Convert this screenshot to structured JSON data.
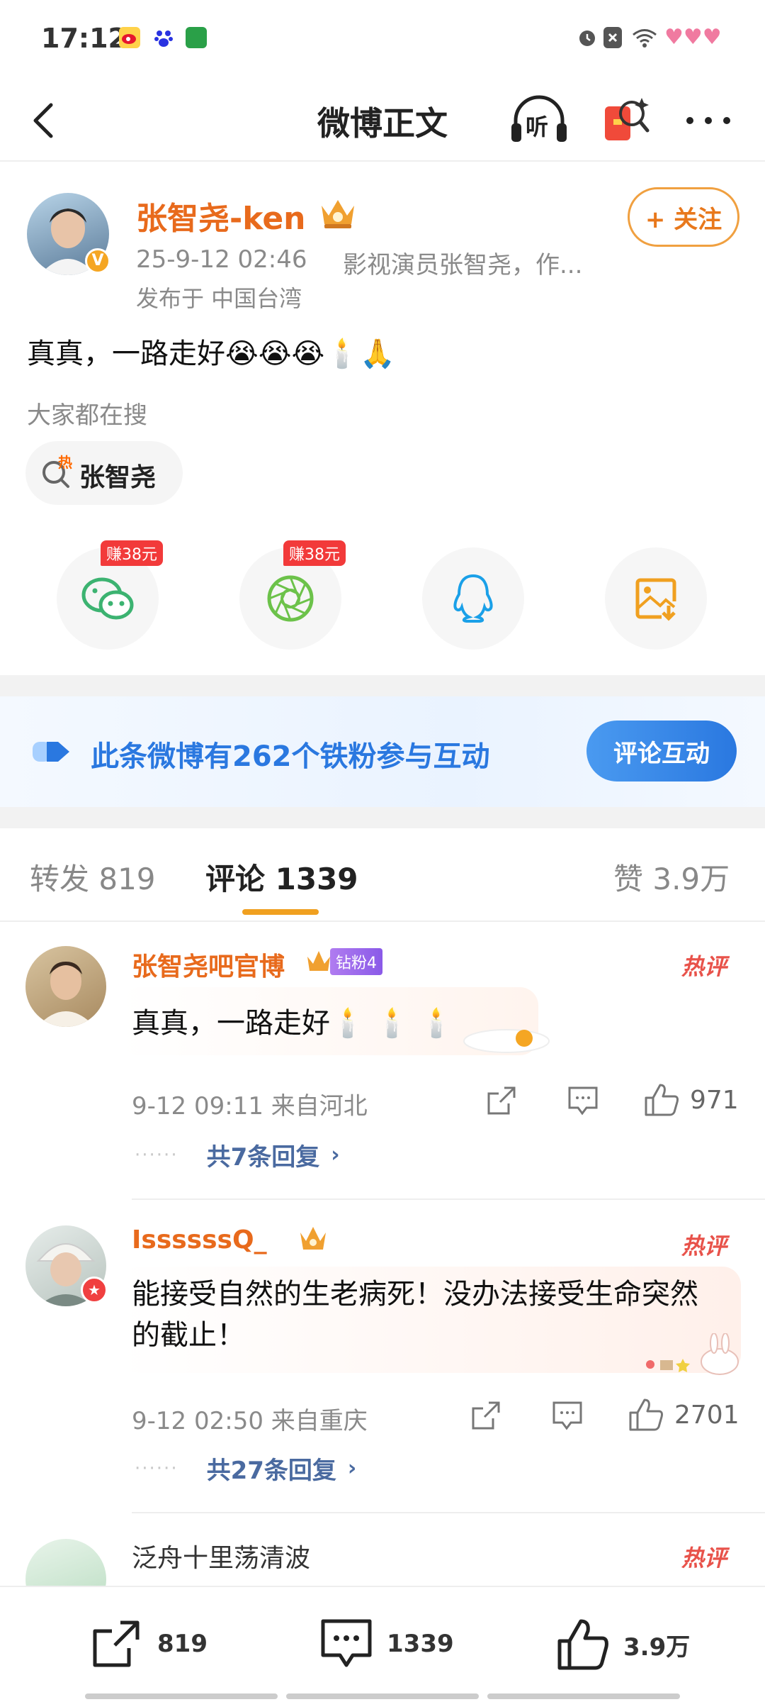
{
  "status_bar": {
    "time": "17:12",
    "left_icons": [
      "weibo-icon",
      "baidu-icon",
      "app-icon"
    ],
    "right_icons": [
      "alarm-icon",
      "close-box-icon",
      "wifi-icon",
      "hearts-icon"
    ]
  },
  "nav": {
    "title": "微博正文",
    "listen_label": "听",
    "icons": [
      "back-arrow-icon",
      "headphones-icon",
      "red-envelope-search-icon",
      "more-icon"
    ]
  },
  "post": {
    "author_name": "张智尧-ken",
    "timestamp": "25-9-12 02:46",
    "author_desc": "影视演员张智尧，作...",
    "location": "发布于 中国台湾",
    "follow_label": "+ 关注",
    "content": "真真，一路走好😭😭😭🕯️🙏",
    "search_hint": "大家都在搜",
    "hot_search_term": "张智尧",
    "hot_search_badge": "热"
  },
  "share": {
    "items": [
      {
        "name": "wechat",
        "badge": "赚38元"
      },
      {
        "name": "moments",
        "badge": "赚38元"
      },
      {
        "name": "qq",
        "badge": ""
      },
      {
        "name": "save-image",
        "badge": ""
      }
    ]
  },
  "fans_banner": {
    "text": "此条微博有262个铁粉参与互动",
    "button": "评论互动"
  },
  "tabs": {
    "repost": "转发 819",
    "comments": "评论 1339",
    "likes": "赞 3.9万"
  },
  "comments": [
    {
      "user": "张智尧吧官博",
      "fan_badge": "钻粉4",
      "text": "真真，一路走好🕯️ 🕯️ 🕯️",
      "time_loc": "9-12 09:11  来自河北",
      "likes": "971",
      "replies": "共7条回复",
      "hot": "热评"
    },
    {
      "user": "IssssssQ_",
      "fan_badge": "",
      "text": "能接受自然的生老病死！没办法接受生命突然的截止！",
      "time_loc": "9-12 02:50  来自重庆",
      "likes": "2701",
      "replies": "共27条回复",
      "hot": "热评"
    },
    {
      "user": "泛舟十里荡清波",
      "hot": "热评"
    }
  ],
  "bottom_bar": {
    "repost": "819",
    "comment": "1339",
    "like": "3.9万"
  },
  "colors": {
    "accent_orange": "#e86a1c",
    "link_blue": "#4a6aa0",
    "banner_blue": "#2a78e0",
    "hot_red": "#e8524a"
  }
}
